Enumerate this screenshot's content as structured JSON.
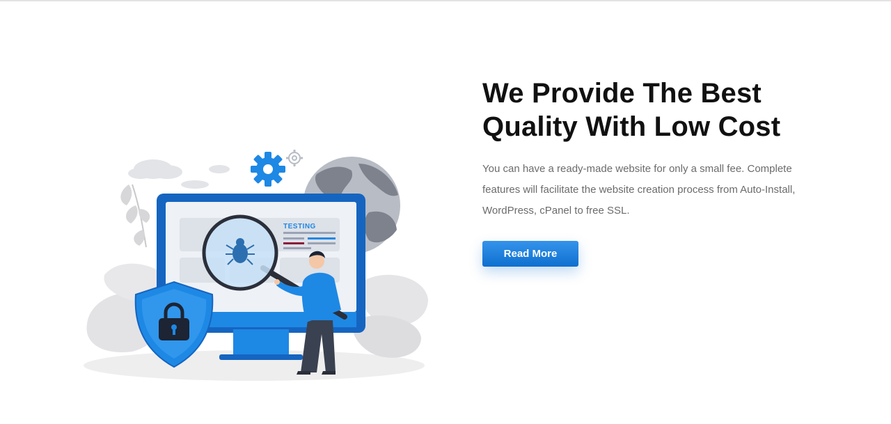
{
  "hero": {
    "title_line1": "We Provide The Best",
    "title_line2": "Quality With Low Cost",
    "description": "You can have a ready-made website for only a small fee. Complete features will facilitate the website creation process from Auto-Install, WordPress, cPanel to free SSL.",
    "button_label": "Read More"
  },
  "illustration": {
    "screen_label": "TESTING",
    "icons": [
      "gear-icon",
      "small-gear-icon",
      "globe-icon",
      "cloud-icon",
      "bug-icon",
      "magnifier-icon",
      "shield-lock-icon",
      "person-icon",
      "leaf-icon"
    ]
  },
  "colors": {
    "accent": "#1e88e5",
    "button": "#1a7bdc",
    "headline": "#111111",
    "body_text": "#6b6b6b",
    "monitor": "#1565c0"
  }
}
